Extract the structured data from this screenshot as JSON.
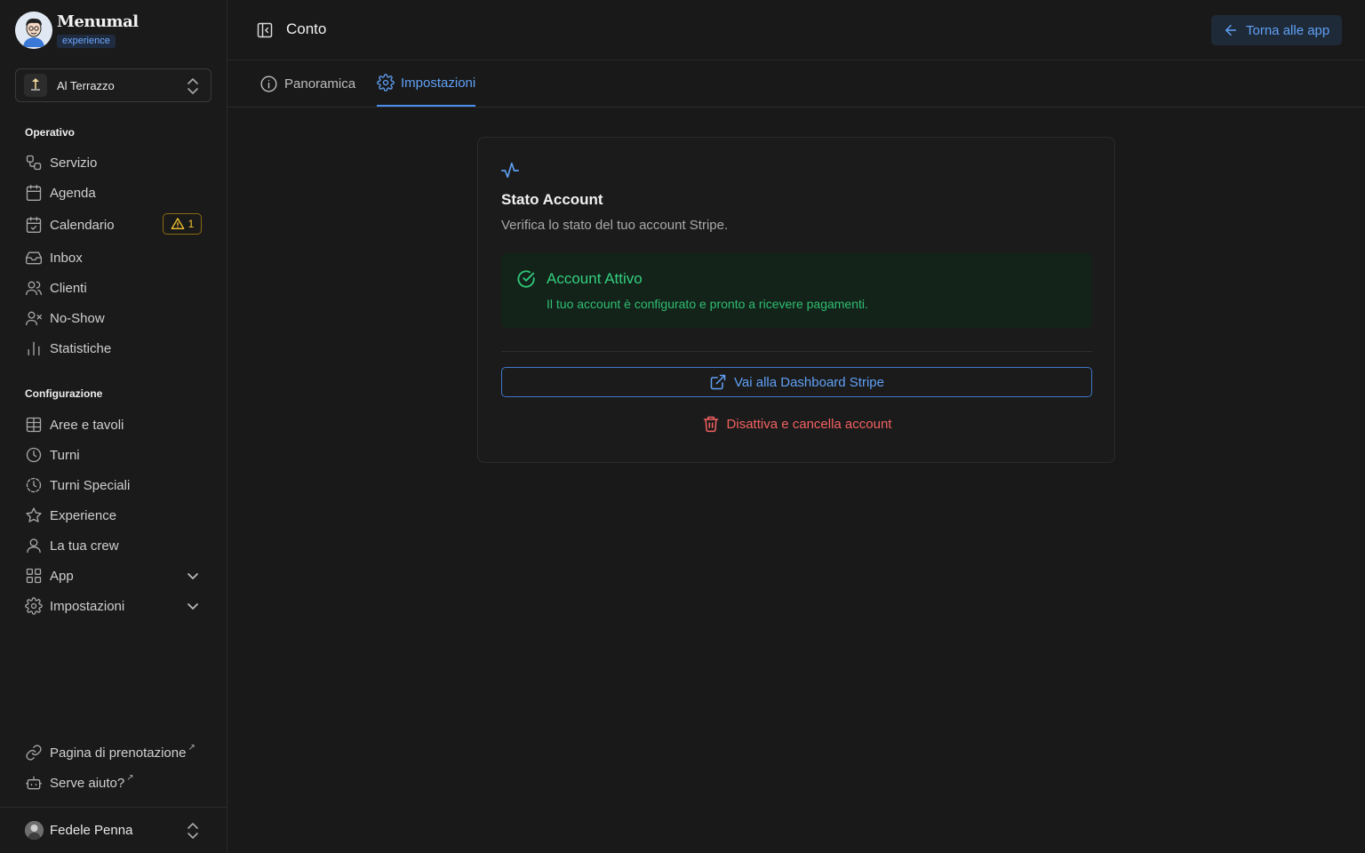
{
  "brand": {
    "name": "Menumal",
    "badge": "experience"
  },
  "venue": {
    "name": "Al Terrazzo"
  },
  "sidebar": {
    "sections": [
      {
        "label": "Operativo",
        "items": [
          {
            "label": "Servizio",
            "icon": "workflow-icon"
          },
          {
            "label": "Agenda",
            "icon": "calendar-icon"
          },
          {
            "label": "Calendario",
            "icon": "calendar-check-icon",
            "badge": "1"
          },
          {
            "label": "Inbox",
            "icon": "inbox-icon"
          },
          {
            "label": "Clienti",
            "icon": "users-icon"
          },
          {
            "label": "No-Show",
            "icon": "user-x-icon"
          },
          {
            "label": "Statistiche",
            "icon": "bar-chart-icon"
          }
        ]
      },
      {
        "label": "Configurazione",
        "items": [
          {
            "label": "Aree e tavoli",
            "icon": "table-icon"
          },
          {
            "label": "Turni",
            "icon": "clock-icon"
          },
          {
            "label": "Turni Speciali",
            "icon": "clock-dashed-icon"
          },
          {
            "label": "Experience",
            "icon": "star-icon"
          },
          {
            "label": "La tua crew",
            "icon": "user-icon"
          },
          {
            "label": "App",
            "icon": "grid-icon"
          },
          {
            "label": "Impostazioni",
            "icon": "gear-icon"
          }
        ]
      }
    ],
    "footer_links": [
      {
        "label": "Pagina di prenotazione",
        "icon": "link-icon"
      },
      {
        "label": "Serve aiuto?",
        "icon": "bot-icon"
      }
    ],
    "external_mark": "↗",
    "user": {
      "name": "Fedele Penna"
    }
  },
  "header": {
    "title": "Conto",
    "back_label": "Torna alle app"
  },
  "tabs": [
    {
      "label": "Panoramica",
      "active": false
    },
    {
      "label": "Impostazioni",
      "active": true
    }
  ],
  "card": {
    "title": "Stato Account",
    "subtitle": "Verifica lo stato del tuo account Stripe.",
    "status": {
      "title": "Account Attivo",
      "description": "Il tuo account è configurato e pronto a ricevere pagamenti."
    },
    "dashboard_label": "Vai alla Dashboard Stripe",
    "delete_label": "Disattiva e cancella account"
  },
  "colors": {
    "accent": "#5fa0f5",
    "success": "#33cf7e",
    "danger": "#f26161",
    "warning": "#f5c430",
    "background": "#191919"
  }
}
